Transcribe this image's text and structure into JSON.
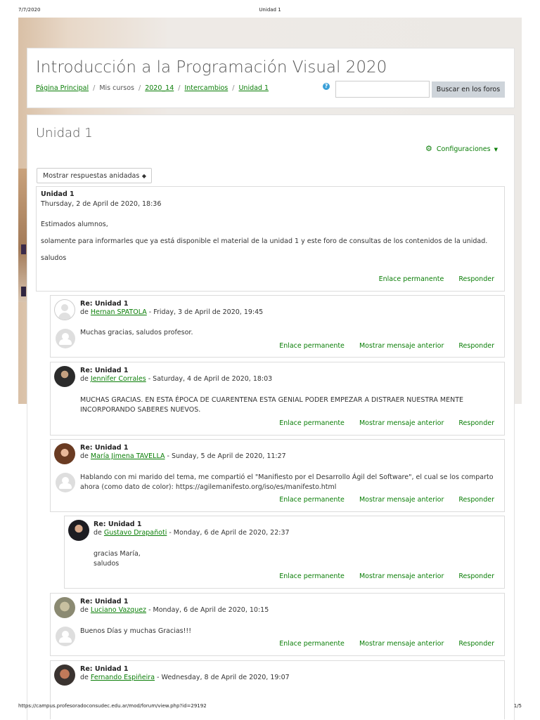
{
  "print_header": {
    "date": "7/7/2020",
    "title": "Unidad 1"
  },
  "print_footer": {
    "url": "https://campus.profesoradoconsudec.edu.ar/mod/forum/view.php?id=29192",
    "page": "1/5"
  },
  "course": {
    "title": "Introducción a la Programación Visual 2020",
    "breadcrumb": [
      "Página Principal",
      "Mis cursos",
      "2020_14",
      "Intercambios",
      "Unidad 1"
    ],
    "search_button": "Buscar en los foros",
    "help_glyph": "?"
  },
  "forum": {
    "title": "Unidad 1",
    "settings_label": "Configuraciones",
    "display_mode": "Mostrar respuestas anidadas"
  },
  "labels": {
    "permalink": "Enlace permanente",
    "show_parent": "Mostrar mensaje anterior",
    "reply": "Responder",
    "by": "de"
  },
  "posts": [
    {
      "subject": "Unidad 1",
      "date": "Thursday, 2 de April de 2020, 18:36",
      "body": [
        "Estimados alumnos,",
        "solamente para informarles que ya está disponible el material de la unidad 1 y este foro de consultas de los contenidos de la unidad.",
        "saludos"
      ]
    },
    {
      "subject": "Re: Unidad 1",
      "author": "Hernan SPATOLA",
      "date": " - Friday, 3 de April de 2020, 19:45",
      "body": [
        "Muchas gracias, saludos profesor."
      ]
    },
    {
      "subject": "Re: Unidad 1",
      "author": "Jennifer Corrales",
      "date": " - Saturday, 4 de April de 2020, 18:03",
      "body": [
        "MUCHAS GRACIAS. EN ESTA ÉPOCA DE CUARENTENA ESTA GENIAL PODER EMPEZAR A DISTRAER NUESTRA MENTE INCORPORANDO SABERES NUEVOS."
      ]
    },
    {
      "subject": "Re: Unidad 1",
      "author": "María Jimena TAVELLA",
      "date": " - Sunday, 5 de April de 2020, 11:27",
      "body": [
        "Hablando con mi marido del tema, me compartió el \"Manifiesto por el Desarrollo Ágil del Software\", el cual se los comparto ahora (como dato de color): https://agilemanifesto.org/iso/es/manifesto.html"
      ]
    },
    {
      "subject": "Re: Unidad 1",
      "author": "Gustavo Drapañoti",
      "date": " - Monday, 6 de April de 2020, 22:37",
      "body": [
        "gracias María,",
        "saludos"
      ]
    },
    {
      "subject": "Re: Unidad 1",
      "author": "Luciano Vazquez",
      "date": " - Monday, 6 de April de 2020, 10:15",
      "body": [
        "Buenos Días y muchas Gracias!!!"
      ]
    },
    {
      "subject": "Re: Unidad 1",
      "author": "Fernando Espiñeira",
      "date": " - Wednesday, 8 de April de 2020, 19:07",
      "body": []
    }
  ]
}
